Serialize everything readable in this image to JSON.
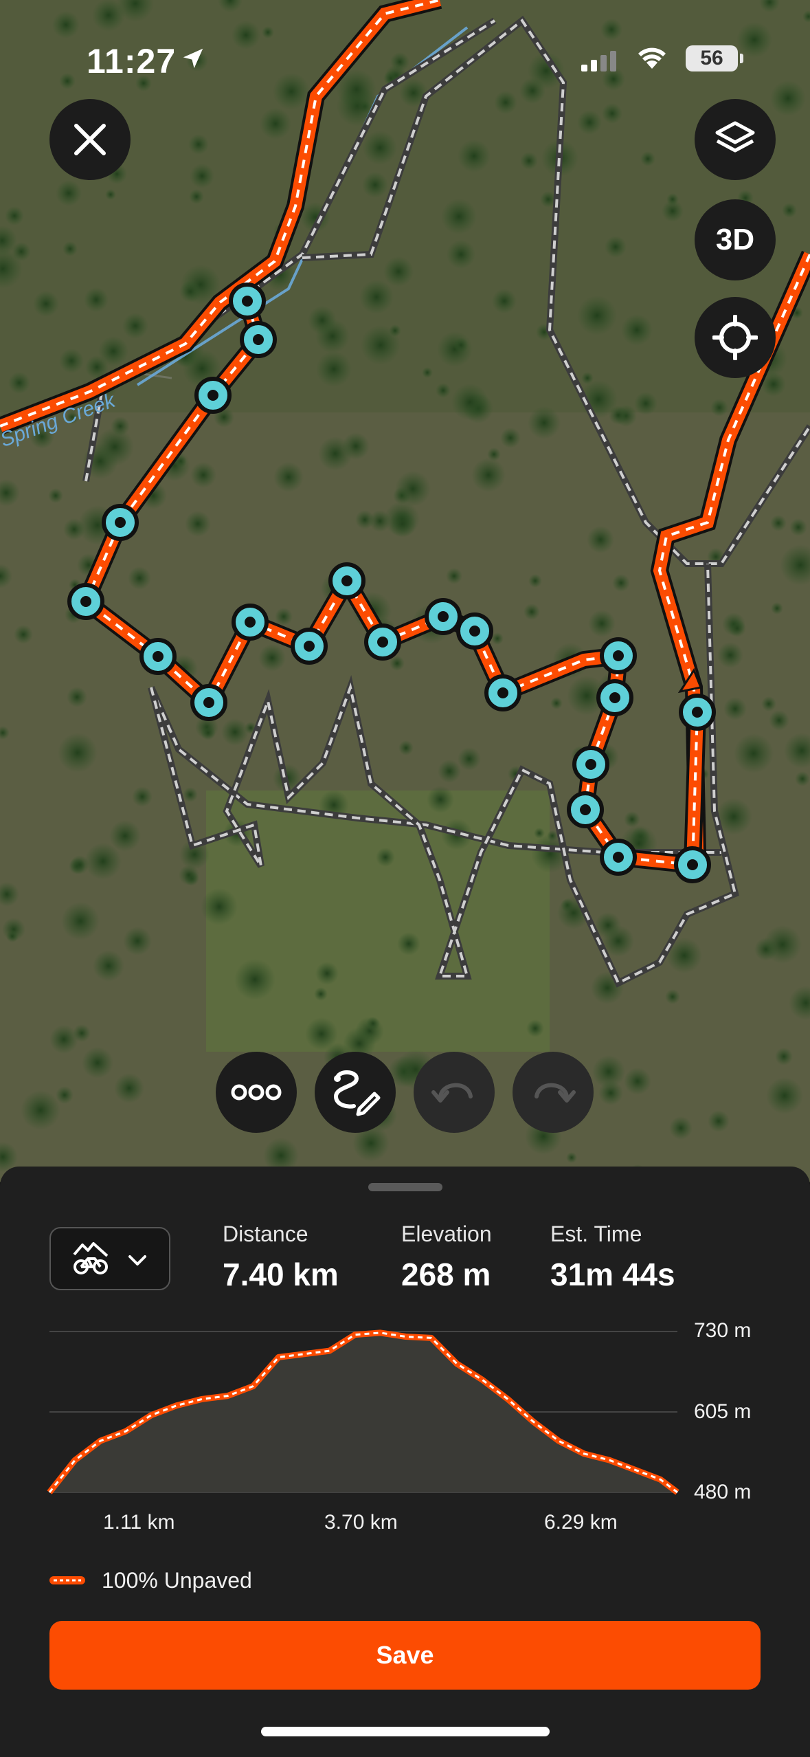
{
  "status_bar": {
    "time": "11:27",
    "battery": "56"
  },
  "map": {
    "water_label": "Spring Creek",
    "buttons": {
      "close_icon": "close-icon",
      "layers_icon": "layers-icon",
      "mode_3d_label": "3D",
      "locate_icon": "crosshair-icon"
    },
    "toolbar": {
      "more_icon": "more-icon",
      "draw_icon": "draw-route-icon",
      "undo_icon": "undo-icon",
      "redo_icon": "redo-icon"
    },
    "colors": {
      "route": "#fc4c02",
      "waypoint": "#5ed0d8",
      "trail": "#a9a9a9",
      "creek": "#6aa9d8"
    }
  },
  "sheet": {
    "activity_icon": "mountain-bike-icon",
    "stats": [
      {
        "label": "Distance",
        "value": "7.40 km"
      },
      {
        "label": "Elevation",
        "value": "268 m"
      },
      {
        "label": "Est. Time",
        "value": "31m 44s"
      }
    ],
    "legend": "100% Unpaved",
    "save_label": "Save"
  },
  "chart_data": {
    "type": "area",
    "xlabel": "",
    "ylabel": "",
    "ylim": [
      480,
      730
    ],
    "xlim": [
      0,
      7.4
    ],
    "y_tick_labels": [
      "730 m",
      "605 m",
      "480 m"
    ],
    "x_tick_labels": [
      "1.11 km",
      "3.70 km",
      "6.29 km"
    ],
    "series": [
      {
        "x": [
          0,
          0.3,
          0.6,
          0.9,
          1.2,
          1.5,
          1.8,
          2.1,
          2.4,
          2.7,
          3.0,
          3.3,
          3.6,
          3.9,
          4.2,
          4.5,
          4.8,
          5.1,
          5.4,
          5.7,
          6.0,
          6.3,
          6.6,
          6.9,
          7.2,
          7.4
        ],
        "y": [
          480,
          530,
          560,
          575,
          600,
          615,
          625,
          630,
          645,
          690,
          695,
          700,
          725,
          728,
          722,
          720,
          680,
          655,
          625,
          590,
          560,
          540,
          530,
          515,
          500,
          480
        ]
      }
    ]
  }
}
